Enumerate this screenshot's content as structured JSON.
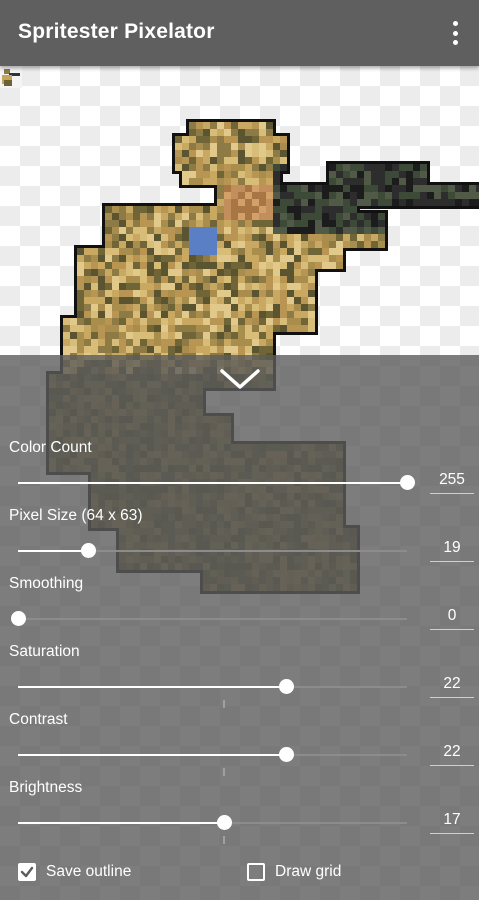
{
  "app": {
    "title": "Spritester Pixelator",
    "menu_icon": "overflow-menu-icon"
  },
  "panel": {
    "collapse_icon": "chevron-down-icon",
    "controls": [
      {
        "label": "Color Count",
        "value": "255",
        "fraction": 1.0
      },
      {
        "label": "Pixel Size (64 x 63)",
        "value": "19",
        "fraction": 0.18
      },
      {
        "label": "Smoothing",
        "value": "0",
        "fraction": 0.0
      },
      {
        "label": "Saturation",
        "value": "22",
        "fraction": 0.69,
        "center_tick": true
      },
      {
        "label": "Contrast",
        "value": "22",
        "fraction": 0.69,
        "center_tick": true
      },
      {
        "label": "Brightness",
        "value": "17",
        "fraction": 0.53,
        "center_tick": true
      }
    ],
    "checkboxes": [
      {
        "label": "Save outline",
        "checked": true
      },
      {
        "label": "Draw grid",
        "checked": false
      }
    ]
  },
  "colors": {
    "appbar": "#5f5f5f",
    "panel_overlay": "#5c5c5c",
    "slider_active": "#ffffff"
  }
}
